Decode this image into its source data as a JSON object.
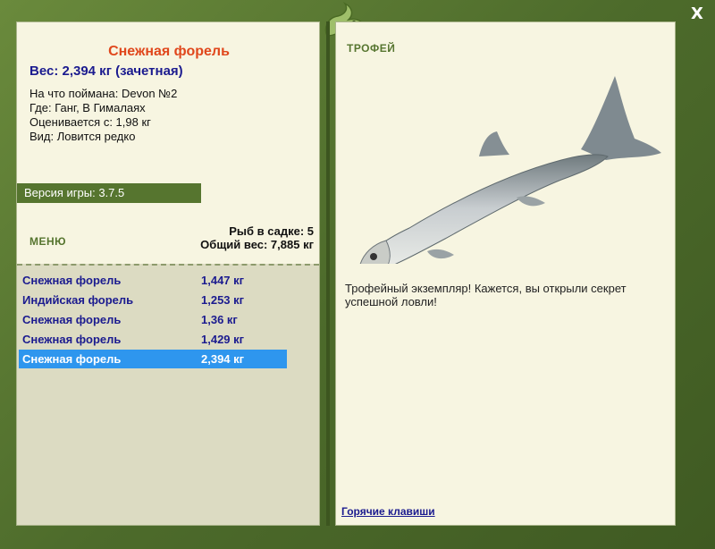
{
  "window": {
    "close_symbol": "X"
  },
  "fish_info": {
    "title": "Снежная форель",
    "weight_line": "Вес: 2,394 кг (зачетная)",
    "lure_line": "На что поймана: Devon №2",
    "location_line": "Где: Ганг, В Гималаях",
    "value_line": "Оценивается с: 1,98 кг",
    "kind_line": "Вид: Ловится редко"
  },
  "version": "Версия игры: 3.7.5",
  "menu": {
    "label": "МЕНЮ"
  },
  "keepnet": {
    "count_line": "Рыб в садке: 5",
    "total_line": "Общий вес: 7,885 кг"
  },
  "catch_list": [
    {
      "name": "Снежная форель",
      "weight": "1,447 кг",
      "selected": false
    },
    {
      "name": "Индийская форель",
      "weight": "1,253 кг",
      "selected": false
    },
    {
      "name": "Снежная форель",
      "weight": "1,36 кг",
      "selected": false
    },
    {
      "name": "Снежная форель",
      "weight": "1,429 кг",
      "selected": false
    },
    {
      "name": "Снежная форель",
      "weight": "2,394 кг",
      "selected": true
    }
  ],
  "trophy": {
    "label": "ТРОФЕЙ",
    "message": "Трофейный экземпляр! Кажется, вы открыли секрет успешной ловли!"
  },
  "hotkeys": {
    "label": "Горячие клавиши"
  },
  "colors": {
    "frame_green": "#4e6e2a",
    "panel_bg": "#f7f5e1",
    "title_orange": "#e0471c",
    "link_blue": "#1b1b8f",
    "selection_blue": "#2e96ee"
  },
  "icons": {
    "logo": "green-lizard-logo",
    "close": "close-icon",
    "fish": "trout-image"
  }
}
